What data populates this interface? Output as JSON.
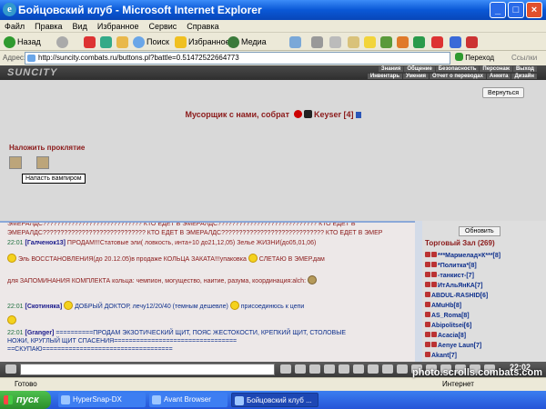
{
  "window": {
    "title": "Бойцовский клуб - Microsoft Internet Explorer"
  },
  "menu": [
    "Файл",
    "Правка",
    "Вид",
    "Избранное",
    "Сервис",
    "Справка"
  ],
  "toolbar": {
    "back": "Назад",
    "search": "Поиск",
    "favorites": "Избранное",
    "media": "Медиа"
  },
  "address": {
    "label": "Адрес:",
    "url": "http://suncity.combats.ru/buttons.pl?battle=0.51472522664773",
    "go": "Переход",
    "links": "Ссылки"
  },
  "site": {
    "logo": "SUNCITY",
    "nav_top": [
      "Знания",
      "Общение",
      "Безопасность",
      "Персонаж",
      "Выход"
    ],
    "nav_bottom": [
      "Инвентарь",
      "Умения",
      "Отчет о переводах",
      "Анкета",
      "Дизайн"
    ],
    "return_btn": "Вернуться",
    "battle_pre": "Мусорщик с нами, собрат",
    "battle_name": "Keyser [4]",
    "curse_title": "Наложить проклятие",
    "tooltip": "Напасть вампиром"
  },
  "chat": {
    "lines": [
      {
        "text": "ЭМЕРАЛДС???????????????????????????? КТО ЕДЕТ В ЭМЕРАЛДС???????????????????????????? КТО ЕДЕТ В"
      },
      {
        "text": "ЭМЕРАЛДС????????????????????????????? КТО ЕДЕТ В ЭМЕРАЛДС????????????????????????????? КТО ЕДЕТ В ЭМЕР"
      },
      {
        "time": "22:01",
        "nick": "[Галченок13]",
        "text": "ПРОДАМ!!!Статовые эли( ловкость, инта+10 до21,12,05) Зелье ЖИЗНИ(до05,01,06)"
      },
      {
        "text": "Эль ВОССТАНОВЛЕНИЯ(до 20.12.05)в продаже КОЛЬЦА ЗАКАТА!!!упаковка",
        "text2": "СЛЕТАЮ В ЭМЕР.дам"
      },
      {
        "text": "для ЗАПОМИНАНИЯ КОМПЛЕКТА кольца: чемпион, могущество, наитие, разума, координация:alch:"
      },
      {
        "time": "22:01",
        "nick": "[Скотиняка]",
        "text": "ДОБРЫЙ ДОКТОР, лечу12/20/40 (темным дешевле)",
        "text2": "присоединюсь к цепи"
      },
      {
        "time": "22:01",
        "nick": "[Granger]",
        "text": "==========ПРОДАМ ЭКЗОТИЧЕСКИЙ ЩИТ, ПОЯС ЖЕСТОКОСТИ, КРЕПКИЙ ЩИТ, СТОЛОВЫЕ"
      },
      {
        "text": "НОЖИ, КРУГЛЫЙ ЩИТ СПАСЕНИЯ================================="
      },
      {
        "text": "==СКУПАЮ==================================="
      }
    ]
  },
  "online": {
    "update": "Обновить",
    "hall": "Торговый Зал (269)",
    "users": [
      "***Мармелад×К***[8]",
      "*Политка*[8]",
      "-танкист-[7]",
      "ИтАльЯнКА[7]",
      "ABDUL-RASHID[6]",
      "AMuHb[8]",
      "AS_Roma[8]",
      "Abipolitsei[6]",
      "Acacia[8]",
      "Aenye Laun[7]",
      "Akant[7]"
    ]
  },
  "clock": "22:02",
  "status": {
    "left": "Готово",
    "right": "Интернет"
  },
  "taskbar": {
    "start": "пуск",
    "tasks": [
      "HyperSnap-DX",
      "Avant Browser",
      "Бойцовский клуб ..."
    ]
  },
  "watermark": "photo.scrolls.combats.com"
}
